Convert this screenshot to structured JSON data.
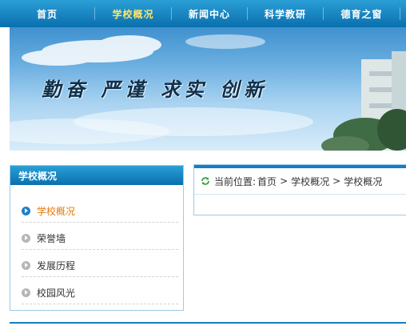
{
  "nav": {
    "items": [
      {
        "label": "首页",
        "active": false
      },
      {
        "label": "学校概况",
        "active": true
      },
      {
        "label": "新闻中心",
        "active": false
      },
      {
        "label": "科学教研",
        "active": false
      },
      {
        "label": "德育之窗",
        "active": false
      }
    ],
    "active_color": "#ffe66a"
  },
  "banner": {
    "slogan": "勤奋 严谨 求实 创新"
  },
  "sidebar": {
    "title": "学校概况",
    "items": [
      {
        "label": "学校概况",
        "active": true
      },
      {
        "label": "荣誉墙",
        "active": false
      },
      {
        "label": "发展历程",
        "active": false
      },
      {
        "label": "校园风光",
        "active": false
      }
    ],
    "active_color": "#e27a0c"
  },
  "breadcrumb": {
    "prefix": "当前位置:",
    "items": [
      "首页",
      "学校概况",
      "学校概况"
    ],
    "separator": ">"
  },
  "colors": {
    "brand_blue": "#1a7cc0"
  }
}
